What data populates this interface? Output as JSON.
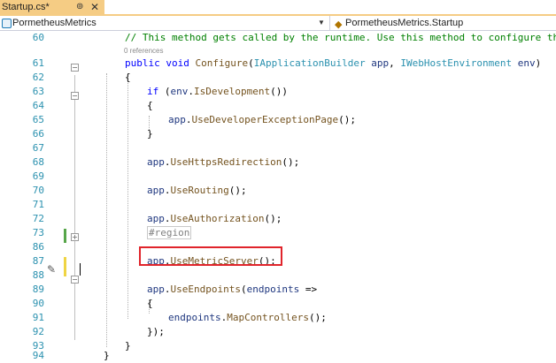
{
  "tab": {
    "title": "Startup.cs*",
    "pin_icon": "pin-icon",
    "close_icon": "close-icon"
  },
  "navbar": {
    "left_label": "PormetheusMetrics",
    "right_label": "PormetheusMetrics.Startup"
  },
  "code_lens": {
    "references": "0 references"
  },
  "lines": [
    {
      "num": "60",
      "text": "// This method gets called by the runtime. Use this method to configure the"
    },
    {
      "num": "61",
      "text": "public void Configure(IApplicationBuilder app, IWebHostEnvironment env)"
    },
    {
      "num": "62",
      "text": "{"
    },
    {
      "num": "63",
      "text": "if (env.IsDevelopment())"
    },
    {
      "num": "64",
      "text": "{"
    },
    {
      "num": "65",
      "text": "app.UseDeveloperExceptionPage();"
    },
    {
      "num": "66",
      "text": "}"
    },
    {
      "num": "67",
      "text": ""
    },
    {
      "num": "68",
      "text": "app.UseHttpsRedirection();"
    },
    {
      "num": "69",
      "text": ""
    },
    {
      "num": "70",
      "text": "app.UseRouting();"
    },
    {
      "num": "71",
      "text": ""
    },
    {
      "num": "72",
      "text": "app.UseAuthorization();"
    },
    {
      "num": "73",
      "text": "#region"
    },
    {
      "num": "86",
      "text": ""
    },
    {
      "num": "87",
      "text": "app.UseMetricServer();"
    },
    {
      "num": "88",
      "text": ""
    },
    {
      "num": "89",
      "text": "app.UseEndpoints(endpoints =>"
    },
    {
      "num": "90",
      "text": "{"
    },
    {
      "num": "91",
      "text": "endpoints.MapControllers();"
    },
    {
      "num": "92",
      "text": "});"
    },
    {
      "num": "93",
      "text": "}"
    },
    {
      "num": "94",
      "text": "}"
    }
  ],
  "colors": {
    "keyword": "#0000ff",
    "comment": "#008000",
    "type": "#2b91af",
    "method": "#74531f",
    "parameter": "#1f377f",
    "highlight_box": "#e0242b",
    "tab_active": "#f5cc84",
    "saved_change": "#57a64a",
    "unsaved_change": "#efd443"
  }
}
